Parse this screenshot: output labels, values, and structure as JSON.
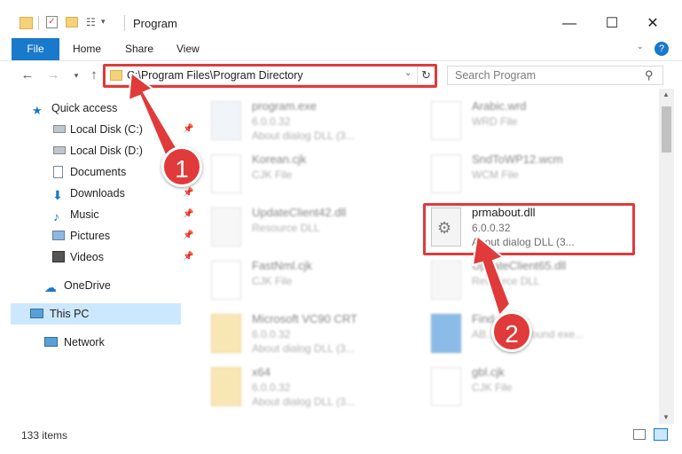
{
  "window": {
    "title": "Program",
    "minimize": "—",
    "maximize": "☐",
    "close": "✕"
  },
  "ribbon": {
    "tabs": [
      "File",
      "Home",
      "Share",
      "View"
    ],
    "help": "?"
  },
  "address": {
    "path": "C:\\Program Files\\Program Directory",
    "search_placeholder": "Search Program"
  },
  "nav": {
    "items": [
      {
        "label": "Quick access",
        "icon": "star-icon",
        "pinned": false
      },
      {
        "label": "Local Disk (C:)",
        "icon": "drive-icon",
        "pinned": true
      },
      {
        "label": "Local Disk (D:)",
        "icon": "drive-icon",
        "pinned": false
      },
      {
        "label": "Documents",
        "icon": "documents-icon",
        "pinned": true
      },
      {
        "label": "Downloads",
        "icon": "download-icon",
        "pinned": true
      },
      {
        "label": "Music",
        "icon": "music-icon",
        "pinned": true
      },
      {
        "label": "Pictures",
        "icon": "pictures-icon",
        "pinned": true
      },
      {
        "label": "Videos",
        "icon": "videos-icon",
        "pinned": true
      },
      {
        "label": "OneDrive",
        "icon": "cloud-icon",
        "pinned": false
      },
      {
        "label": "This PC",
        "icon": "computer-icon",
        "pinned": false,
        "selected": true
      },
      {
        "label": "Network",
        "icon": "network-icon",
        "pinned": false
      }
    ]
  },
  "files": {
    "left": [
      {
        "name": "program.exe",
        "type": "6.0.0.32",
        "desc": "About dialog DLL (3...",
        "icon": "exe-icon"
      },
      {
        "name": "Korean.cjk",
        "type": "CJK File",
        "desc": "",
        "icon": "file-icon"
      },
      {
        "name": "UpdateClient42.dll",
        "type": "Resource DLL",
        "desc": "",
        "icon": "dll-icon"
      },
      {
        "name": "FastNml.cjk",
        "type": "CJK File",
        "desc": "",
        "icon": "file-icon"
      },
      {
        "name": "Microsoft VC90 CRT",
        "type": "6.0.0.32",
        "desc": "About dialog DLL (3...",
        "icon": "folder-icon"
      },
      {
        "name": "x64",
        "type": "6.0.0.32",
        "desc": "About dialog DLL (3...",
        "icon": "folder-icon"
      }
    ],
    "right": [
      {
        "name": "Arabic.wrd",
        "type": "WRD File",
        "desc": "",
        "icon": "file-icon"
      },
      {
        "name": "SndToWP12.wcm",
        "type": "WCM File",
        "desc": "",
        "icon": "file-icon"
      },
      {
        "name": "prmabout.dll",
        "type": "6.0.0.32",
        "desc": "About dialog DLL (3...",
        "icon": "dll-icon",
        "highlighted": true
      },
      {
        "name": "UpdateClient65.dll",
        "type": "Resource DLL",
        "desc": "",
        "icon": "dll-icon"
      },
      {
        "name": "Find...exe",
        "type": "AB... Background exe...",
        "desc": "",
        "icon": "exe-icon"
      },
      {
        "name": "gbl.cjk",
        "type": "CJK File",
        "desc": "",
        "icon": "file-icon"
      }
    ]
  },
  "status": {
    "count": "133 items"
  },
  "annotations": {
    "step1": "1",
    "step2": "2"
  },
  "colors": {
    "accent": "#1979ca",
    "highlight": "#e03a3a",
    "selected": "#cce8ff"
  }
}
